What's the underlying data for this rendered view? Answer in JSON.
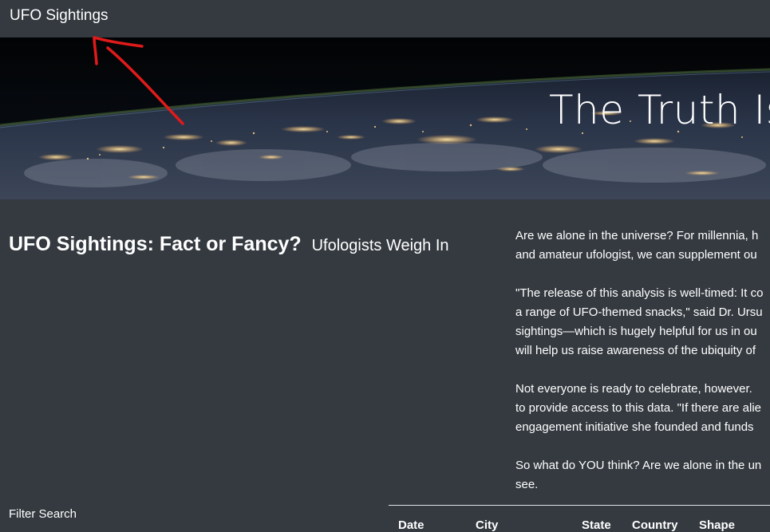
{
  "navbar": {
    "brand": "UFO Sightings"
  },
  "hero": {
    "title": "The Truth Is"
  },
  "headline": {
    "main": "UFO Sightings: Fact or Fancy?",
    "sub": "Ufologists Weigh In"
  },
  "article": {
    "paragraphs": [
      [
        "Are we alone in the universe? For millennia, h",
        "and amateur ufologist, we can supplement ou"
      ],
      [
        "\"The release of this analysis is well-timed: It co",
        "a range of UFO-themed snacks,\" said Dr. Ursu",
        "sightings—which is hugely helpful for us in ou",
        "will help us raise awareness of the ubiquity of"
      ],
      [
        "Not everyone is ready to celebrate, however.",
        "to provide access to this data. \"If there are alie",
        "engagement initiative she founded and funds"
      ],
      [
        "So what do YOU think? Are we alone in the un",
        "see."
      ]
    ]
  },
  "filter": {
    "label": "Filter Search"
  },
  "table": {
    "headers": [
      "Date",
      "City",
      "State",
      "Country",
      "Shape"
    ]
  },
  "colors": {
    "background": "#343a40",
    "text": "#ffffff",
    "annotation": "#e01a1a"
  }
}
